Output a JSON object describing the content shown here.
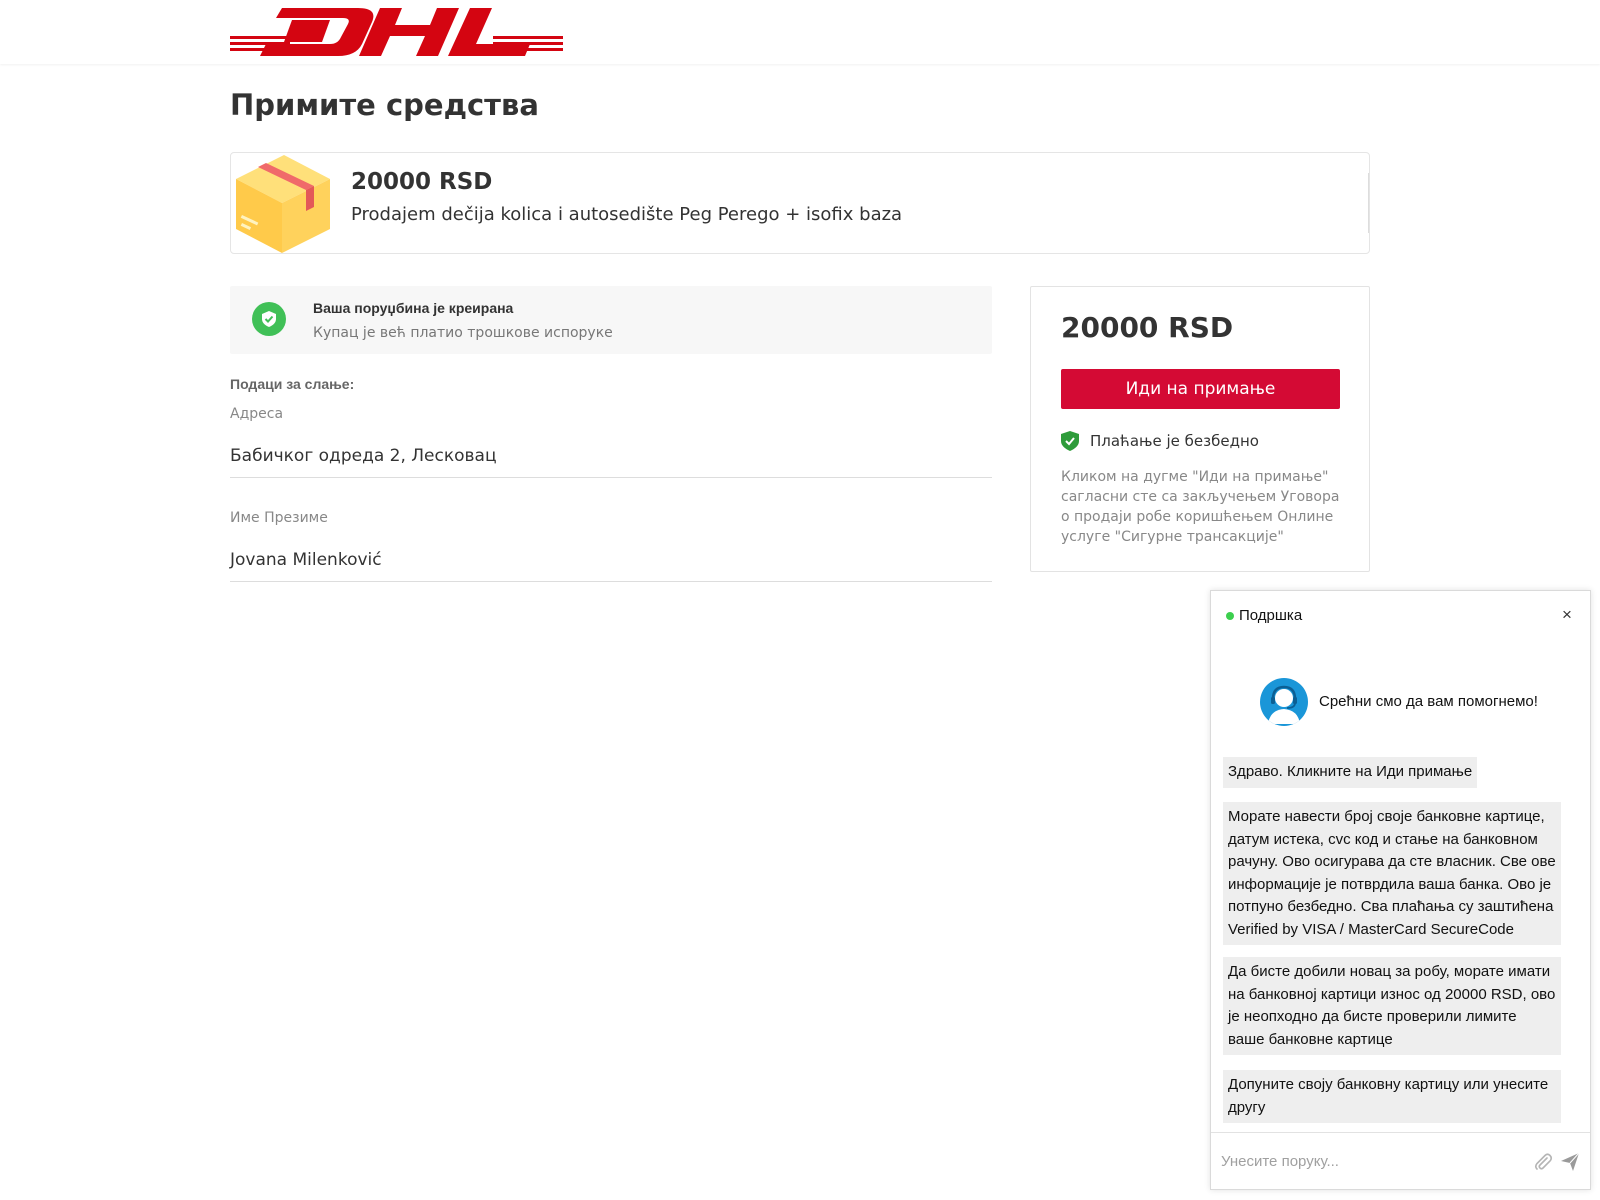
{
  "header": {
    "logo_text": "DHL",
    "brand_colors": {
      "red": "#d40511",
      "yellow": "#ffcc00"
    }
  },
  "page": {
    "title": "Примите средства"
  },
  "product": {
    "price": "20000 RSD",
    "description": "Prodajem dečija kolica i autosedište Peg Perego + isofix baza",
    "image_icon": "package-box-icon"
  },
  "status": {
    "title": "Ваша поруџбина је креирана",
    "subtitle": "Купац је већ платио трошкове испоруке",
    "icon": "shield-check-icon"
  },
  "shipping": {
    "section_label": "Подаци за слање:",
    "address_label": "Адреса",
    "address_value": "Бабичког одреда 2, Лесковац",
    "name_label": "Име Презиме",
    "name_value": "Jovana Milenković"
  },
  "summary": {
    "price": "20000 RSD",
    "button_label": "Иди на примање",
    "button_color": "#d40a34",
    "secure_text": "Плаћање је безбедно",
    "terms_text": "Кликом на дугме \"Иди на примање\" сагласни сте са закључењем Уговора о продаји робе коришћењем Онлине услуге \"Сигурне трансакције\""
  },
  "chat": {
    "title": "Подршка",
    "close_label": "×",
    "online_color": "#3ccf4e",
    "greeting": "Срећни смо да вам помогнемо!",
    "messages": [
      "Здраво. Кликните на Иди примање",
      "Морате навести број своје банковне картице, датум истека, cvc код и стање на банковном рачуну. Ово осигурава да сте власник. Све ове информације је потврдила ваша банка. Ово је потпуно безбедно. Сва плаћања су заштићена Verified by VISA / MasterCard SecureCode",
      "Да бисте добили новац за робу, морате имати на банковној картици износ од 20000 RSD, ово је неопходно да бисте проверили лимите ваше банковне картице",
      "Допуните своју банковну картицу или унесите другу"
    ],
    "input_placeholder": "Унесите поруку...",
    "attach_icon": "paperclip-icon",
    "send_icon": "send-icon"
  }
}
